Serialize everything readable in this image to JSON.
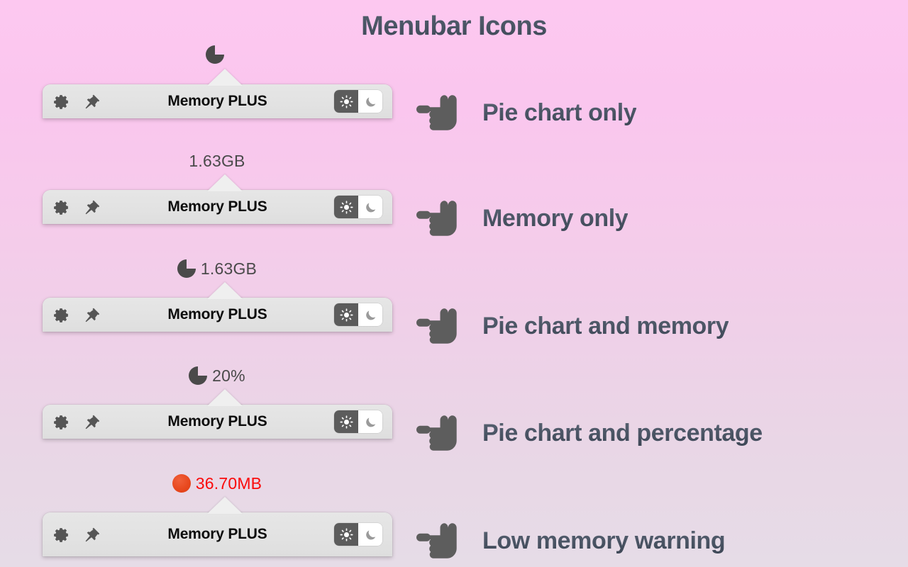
{
  "page": {
    "title": "Menubar Icons",
    "title_color": "#4a5565",
    "background_top": "#fdc8f0",
    "background_bottom": "#e6dce7"
  },
  "popover": {
    "app_title": "Memory PLUS",
    "gear_icon": "gear-icon",
    "pin_icon": "pushpin-icon",
    "mode_toggle": {
      "light_icon": "sun-icon",
      "dark_icon": "moon-icon",
      "selected": "light"
    },
    "card_color": "#e2e2e2"
  },
  "colors": {
    "pie_fill": "#4a4a4a",
    "warning_text": "#fa0a0a",
    "warning_dot": "#e8491f",
    "menubar_text": "#4a4a4a"
  },
  "rows": [
    {
      "menubar_label": "",
      "glyph": "pie",
      "caption": "Pie chart only",
      "hand_icon": "pointing-hand-right-icon"
    },
    {
      "menubar_label": "1.63GB",
      "glyph": "none",
      "caption": "Memory only",
      "hand_icon": "pointing-hand-right-icon"
    },
    {
      "menubar_label": "1.63GB",
      "glyph": "pie",
      "caption": "Pie chart and memory",
      "hand_icon": "pointing-hand-right-icon"
    },
    {
      "menubar_label": "20%",
      "glyph": "pie",
      "caption": "Pie chart and percentage",
      "hand_icon": "pointing-hand-right-icon"
    },
    {
      "menubar_label": "36.70MB",
      "glyph": "alert-dot",
      "caption": "Low memory warning",
      "hand_icon": "pointing-hand-right-icon",
      "warning": true
    }
  ]
}
